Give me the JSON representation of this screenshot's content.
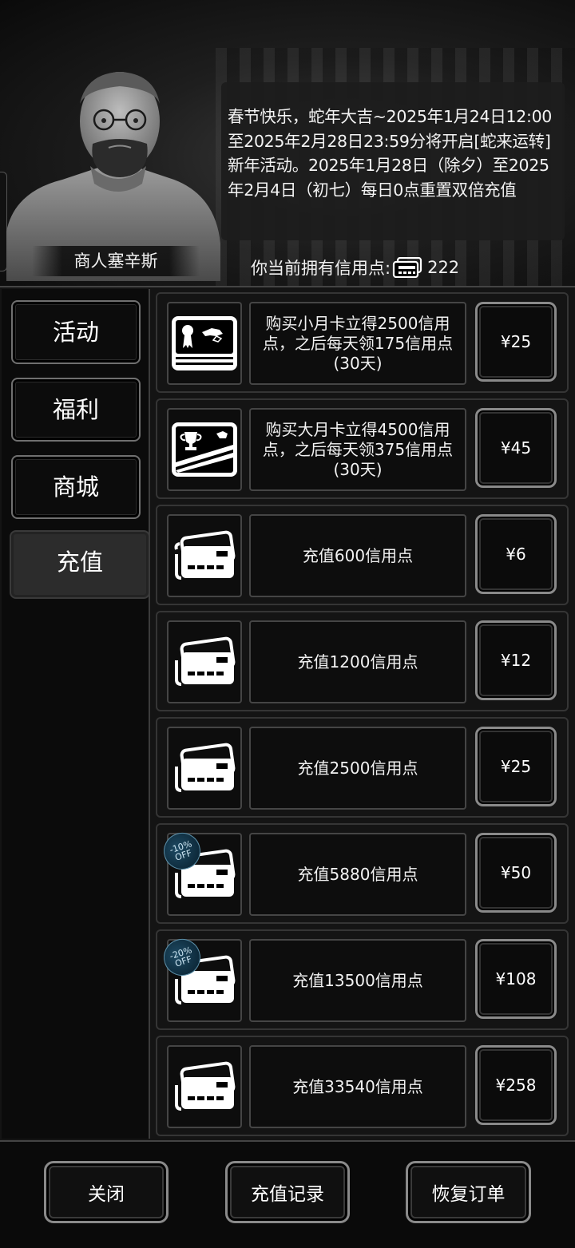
{
  "header": {
    "merchant_name": "商人塞辛斯",
    "announcement": "春节快乐，蛇年大吉~2025年1月24日12:00至2025年2月28日23:59分将开启[蛇来运转]新年活动。2025年1月28日（除夕）至2025年2月4日（初七）每日0点重置双倍充值",
    "credit_label": "你当前拥有信用点:",
    "credit_value": "222",
    "credit_icon": "credit-card-icon"
  },
  "tabs": [
    {
      "label": "活动",
      "active": false
    },
    {
      "label": "福利",
      "active": false
    },
    {
      "label": "商城",
      "active": false
    },
    {
      "label": "充值",
      "active": true
    }
  ],
  "items": [
    {
      "icon": "small-month-card-icon",
      "desc": "购买小月卡立得2500信用点，之后每天领175信用点(30天)",
      "price": "¥25",
      "discount": null
    },
    {
      "icon": "large-month-card-icon",
      "desc": "购买大月卡立得4500信用点，之后每天领375信用点(30天)",
      "price": "¥45",
      "discount": null
    },
    {
      "icon": "credit-cards-icon",
      "desc": "充值600信用点",
      "price": "¥6",
      "discount": null
    },
    {
      "icon": "credit-cards-icon",
      "desc": "充值1200信用点",
      "price": "¥12",
      "discount": null
    },
    {
      "icon": "credit-cards-icon",
      "desc": "充值2500信用点",
      "price": "¥25",
      "discount": null
    },
    {
      "icon": "credit-cards-icon",
      "desc": "充值5880信用点",
      "price": "¥50",
      "discount": {
        "pct": "-10%",
        "word": "OFF"
      }
    },
    {
      "icon": "credit-cards-icon",
      "desc": "充值13500信用点",
      "price": "¥108",
      "discount": {
        "pct": "-20%",
        "word": "OFF"
      }
    },
    {
      "icon": "credit-cards-icon",
      "desc": "充值33540信用点",
      "price": "¥258",
      "discount": null
    }
  ],
  "footer": {
    "close_label": "关闭",
    "history_label": "充值记录",
    "restore_label": "恢复订单"
  },
  "colors": {
    "background": "#000000",
    "panel": "#141414",
    "border": "#8a8a8a",
    "discount_badge": "#1e4a63"
  }
}
